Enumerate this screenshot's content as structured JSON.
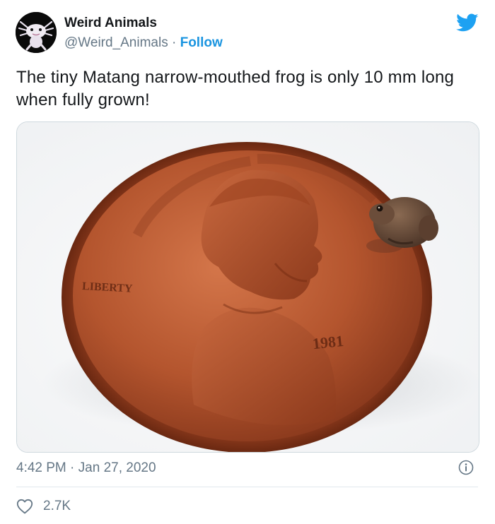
{
  "account": {
    "name": "Weird Animals",
    "handle": "@Weird_Animals",
    "separator": "·",
    "follow_label": "Follow"
  },
  "tweet": {
    "text": "The tiny Matang narrow-mouthed frog is only 10 mm long when fully grown!",
    "time": "4:42 PM",
    "date_separator": "·",
    "date": "Jan 27, 2020",
    "likes": "2.7K"
  },
  "photo": {
    "coin_text_liberty": "LIBERTY",
    "coin_text_year": "1981"
  },
  "icons": {
    "platform": "twitter-bird-icon",
    "info": "info-icon",
    "like": "heart-icon"
  },
  "colors": {
    "accent": "#1b95e0",
    "secondary_text": "#657786",
    "copper": "#b4552e"
  }
}
